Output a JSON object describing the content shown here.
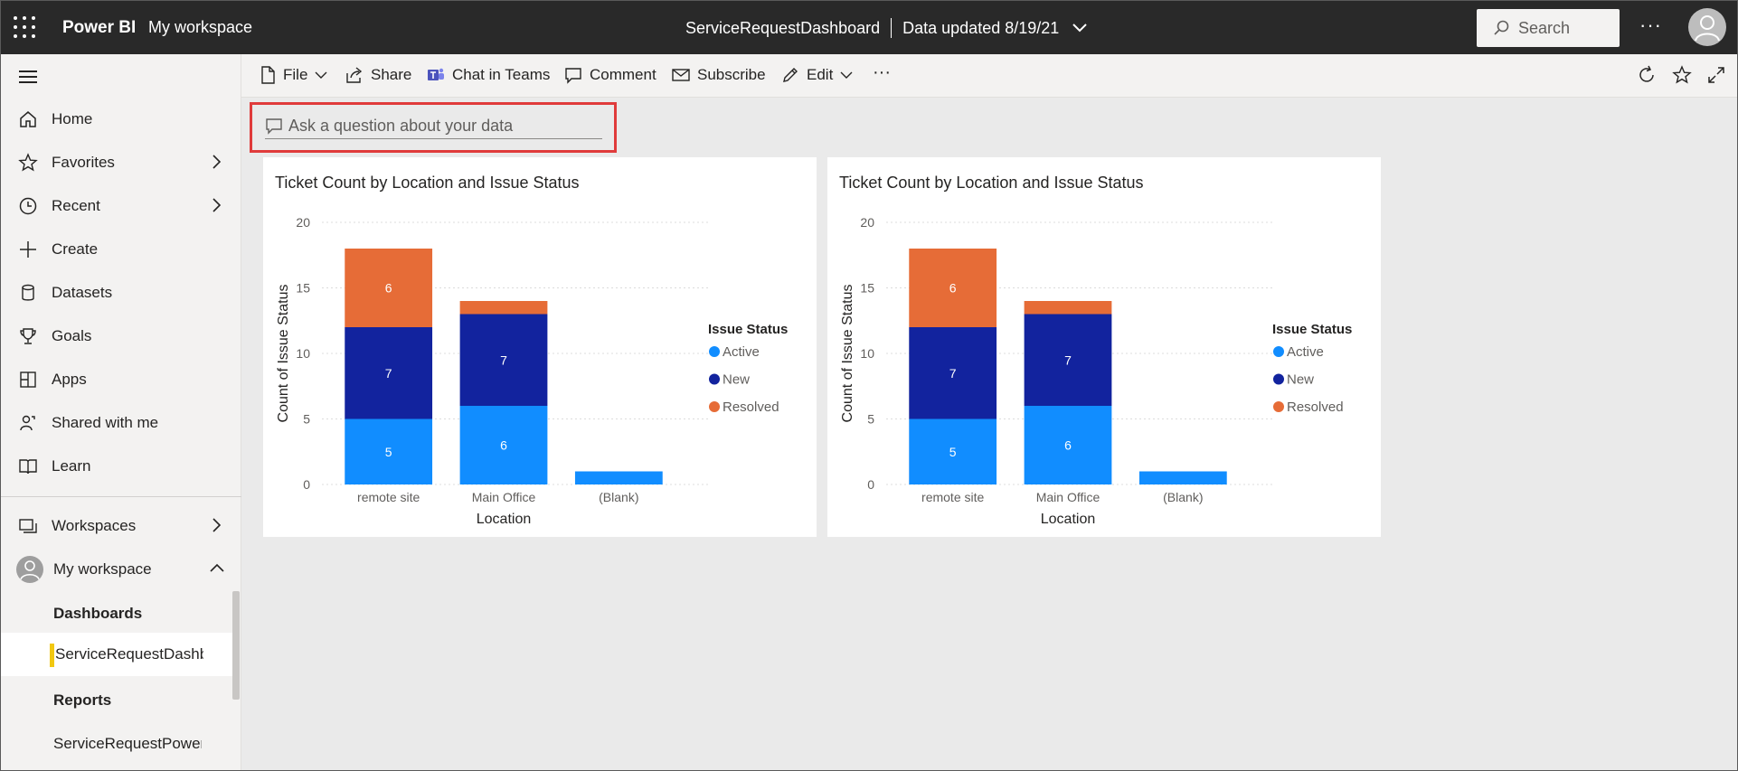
{
  "header": {
    "app_name": "Power BI",
    "workspace_link": "My workspace",
    "dashboard_name": "ServiceRequestDashboard",
    "data_updated": "Data updated 8/19/21",
    "search_placeholder": "Search",
    "more_label": "···"
  },
  "sidebar": {
    "items": [
      {
        "label": "Home",
        "icon": "home-icon"
      },
      {
        "label": "Favorites",
        "icon": "star-icon"
      },
      {
        "label": "Recent",
        "icon": "clock-icon"
      },
      {
        "label": "Create",
        "icon": "plus-icon"
      },
      {
        "label": "Datasets",
        "icon": "database-icon"
      },
      {
        "label": "Goals",
        "icon": "trophy-icon"
      },
      {
        "label": "Apps",
        "icon": "apps-icon"
      },
      {
        "label": "Shared with me",
        "icon": "shared-icon"
      },
      {
        "label": "Learn",
        "icon": "book-icon"
      }
    ],
    "workspaces": "Workspaces",
    "my_workspace": "My workspace",
    "dashboards_heading": "Dashboards",
    "dashboard_item": "ServiceRequestDashboard",
    "reports_heading": "Reports",
    "report_item": "ServiceRequestPowerBI"
  },
  "commandbar": {
    "file": "File",
    "share": "Share",
    "chat_in_teams": "Chat in Teams",
    "comment": "Comment",
    "subscribe": "Subscribe",
    "edit": "Edit",
    "more": "···"
  },
  "qna": {
    "placeholder": "Ask a question about your data"
  },
  "colors": {
    "active": "#118DFF",
    "new": "#12239E",
    "resolved": "#E66C37",
    "accent": "#F2C811"
  },
  "chart_data": [
    {
      "type": "bar",
      "stacked": true,
      "title": "Ticket Count by Location and Issue Status",
      "xlabel": "Location",
      "ylabel": "Count of Issue Status",
      "ylim": [
        0,
        20
      ],
      "yticks": [
        "0",
        "5",
        "10",
        "15",
        "20"
      ],
      "categories": [
        "remote site",
        "Main Office",
        "(Blank)"
      ],
      "legend_title": "Issue Status",
      "legend_position": "right",
      "series": [
        {
          "name": "Active",
          "values": [
            5,
            6,
            1
          ],
          "labels": [
            "5",
            "6",
            ""
          ]
        },
        {
          "name": "New",
          "values": [
            7,
            7,
            0
          ],
          "labels": [
            "7",
            "7",
            ""
          ]
        },
        {
          "name": "Resolved",
          "values": [
            6,
            1,
            0
          ],
          "labels": [
            "6",
            "",
            ""
          ]
        }
      ]
    },
    {
      "type": "bar",
      "stacked": true,
      "title": "Ticket Count by Location and Issue Status",
      "xlabel": "Location",
      "ylabel": "Count of Issue Status",
      "ylim": [
        0,
        20
      ],
      "yticks": [
        "0",
        "5",
        "10",
        "15",
        "20"
      ],
      "categories": [
        "remote site",
        "Main Office",
        "(Blank)"
      ],
      "legend_title": "Issue Status",
      "legend_position": "right",
      "series": [
        {
          "name": "Active",
          "values": [
            5,
            6,
            1
          ],
          "labels": [
            "5",
            "6",
            ""
          ]
        },
        {
          "name": "New",
          "values": [
            7,
            7,
            0
          ],
          "labels": [
            "7",
            "7",
            ""
          ]
        },
        {
          "name": "Resolved",
          "values": [
            6,
            1,
            0
          ],
          "labels": [
            "6",
            "",
            ""
          ]
        }
      ]
    }
  ]
}
